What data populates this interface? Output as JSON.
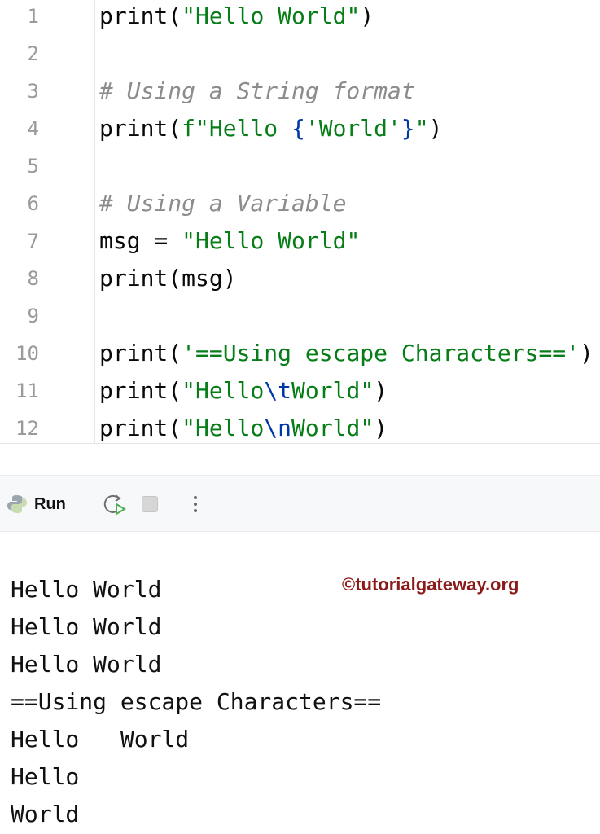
{
  "editor": {
    "lines": [
      {
        "n": "1",
        "tokens": [
          [
            "plain",
            "print("
          ],
          [
            "str",
            "\"Hello World\""
          ],
          [
            "plain",
            ")"
          ]
        ]
      },
      {
        "n": "2",
        "tokens": []
      },
      {
        "n": "3",
        "tokens": [
          [
            "com",
            "# Using a String format"
          ]
        ]
      },
      {
        "n": "4",
        "tokens": [
          [
            "plain",
            "print("
          ],
          [
            "str",
            "f\"Hello "
          ],
          [
            "esc",
            "{"
          ],
          [
            "str",
            "'World'"
          ],
          [
            "esc",
            "}"
          ],
          [
            "str",
            "\""
          ],
          [
            "plain",
            ")"
          ]
        ]
      },
      {
        "n": "5",
        "tokens": []
      },
      {
        "n": "6",
        "tokens": [
          [
            "com",
            "# Using a Variable"
          ]
        ]
      },
      {
        "n": "7",
        "tokens": [
          [
            "plain",
            "msg = "
          ],
          [
            "str",
            "\"Hello World\""
          ]
        ]
      },
      {
        "n": "8",
        "tokens": [
          [
            "plain",
            "print(msg)"
          ]
        ]
      },
      {
        "n": "9",
        "tokens": []
      },
      {
        "n": "10",
        "tokens": [
          [
            "plain",
            "print("
          ],
          [
            "str",
            "'==Using escape Characters=='"
          ],
          [
            "plain",
            ")"
          ]
        ]
      },
      {
        "n": "11",
        "tokens": [
          [
            "plain",
            "print("
          ],
          [
            "str",
            "\"Hello"
          ],
          [
            "esc",
            "\\t"
          ],
          [
            "str",
            "World\""
          ],
          [
            "plain",
            ")"
          ]
        ]
      },
      {
        "n": "12",
        "tokens": [
          [
            "plain",
            "print("
          ],
          [
            "str",
            "\"Hello"
          ],
          [
            "esc",
            "\\n"
          ],
          [
            "str",
            "World\""
          ],
          [
            "plain",
            ")"
          ]
        ]
      }
    ]
  },
  "toolbar": {
    "run_label": "Run",
    "icons": [
      "python-icon",
      "rerun-icon",
      "stop-icon",
      "more-icon"
    ]
  },
  "output": {
    "lines": [
      "Hello World",
      "Hello World",
      "Hello World",
      "==Using escape Characters==",
      "Hello\tWorld",
      "Hello",
      "World"
    ]
  },
  "watermark": "©tutorialgateway.org"
}
